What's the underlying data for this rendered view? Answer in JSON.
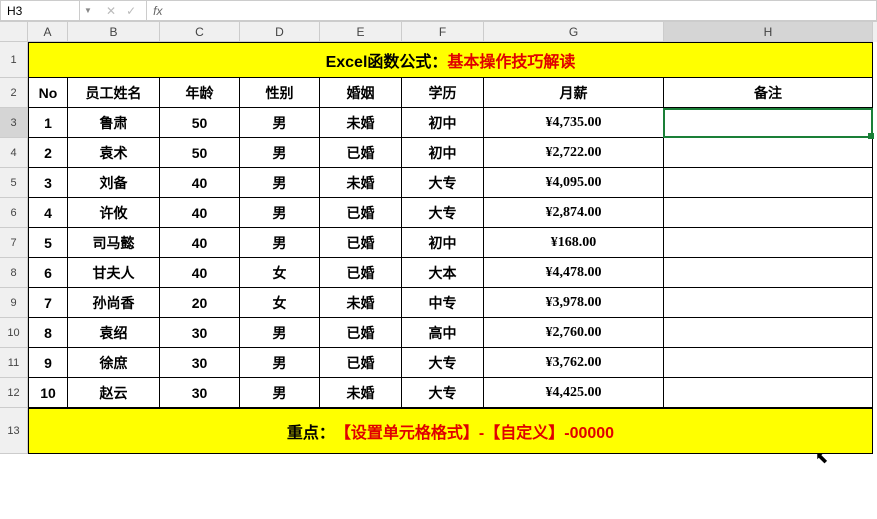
{
  "name_box": {
    "value": "H3"
  },
  "formula_bar": {
    "fx": "fx",
    "value": ""
  },
  "col_headers": [
    "A",
    "B",
    "C",
    "D",
    "E",
    "F",
    "G",
    "H"
  ],
  "row_headers": [
    "1",
    "2",
    "3",
    "4",
    "5",
    "6",
    "7",
    "8",
    "9",
    "10",
    "11",
    "12",
    "13"
  ],
  "title": {
    "part1": "Excel函数公式：",
    "part2": "基本操作技巧解读"
  },
  "table": {
    "headers": {
      "no": "No",
      "name": "员工姓名",
      "age": "年龄",
      "gender": "性别",
      "marriage": "婚姻",
      "edu": "学历",
      "salary": "月薪",
      "note": "备注"
    },
    "rows": [
      {
        "no": "1",
        "name": "鲁肃",
        "age": "50",
        "gender": "男",
        "marriage": "未婚",
        "edu": "初中",
        "salary": "¥4,735.00",
        "note": ""
      },
      {
        "no": "2",
        "name": "袁术",
        "age": "50",
        "gender": "男",
        "marriage": "已婚",
        "edu": "初中",
        "salary": "¥2,722.00",
        "note": ""
      },
      {
        "no": "3",
        "name": "刘备",
        "age": "40",
        "gender": "男",
        "marriage": "未婚",
        "edu": "大专",
        "salary": "¥4,095.00",
        "note": ""
      },
      {
        "no": "4",
        "name": "许攸",
        "age": "40",
        "gender": "男",
        "marriage": "已婚",
        "edu": "大专",
        "salary": "¥2,874.00",
        "note": ""
      },
      {
        "no": "5",
        "name": "司马懿",
        "age": "40",
        "gender": "男",
        "marriage": "已婚",
        "edu": "初中",
        "salary": "¥168.00",
        "note": ""
      },
      {
        "no": "6",
        "name": "甘夫人",
        "age": "40",
        "gender": "女",
        "marriage": "已婚",
        "edu": "大本",
        "salary": "¥4,478.00",
        "note": ""
      },
      {
        "no": "7",
        "name": "孙尚香",
        "age": "20",
        "gender": "女",
        "marriage": "未婚",
        "edu": "中专",
        "salary": "¥3,978.00",
        "note": ""
      },
      {
        "no": "8",
        "name": "袁绍",
        "age": "30",
        "gender": "男",
        "marriage": "已婚",
        "edu": "高中",
        "salary": "¥2,760.00",
        "note": ""
      },
      {
        "no": "9",
        "name": "徐庶",
        "age": "30",
        "gender": "男",
        "marriage": "已婚",
        "edu": "大专",
        "salary": "¥3,762.00",
        "note": ""
      },
      {
        "no": "10",
        "name": "赵云",
        "age": "30",
        "gender": "男",
        "marriage": "未婚",
        "edu": "大专",
        "salary": "¥4,425.00",
        "note": ""
      }
    ]
  },
  "footer": {
    "part1": "重点：",
    "part2": "【设置单元格格式】-【自定义】-00000"
  },
  "active_cell_ref": "H3"
}
